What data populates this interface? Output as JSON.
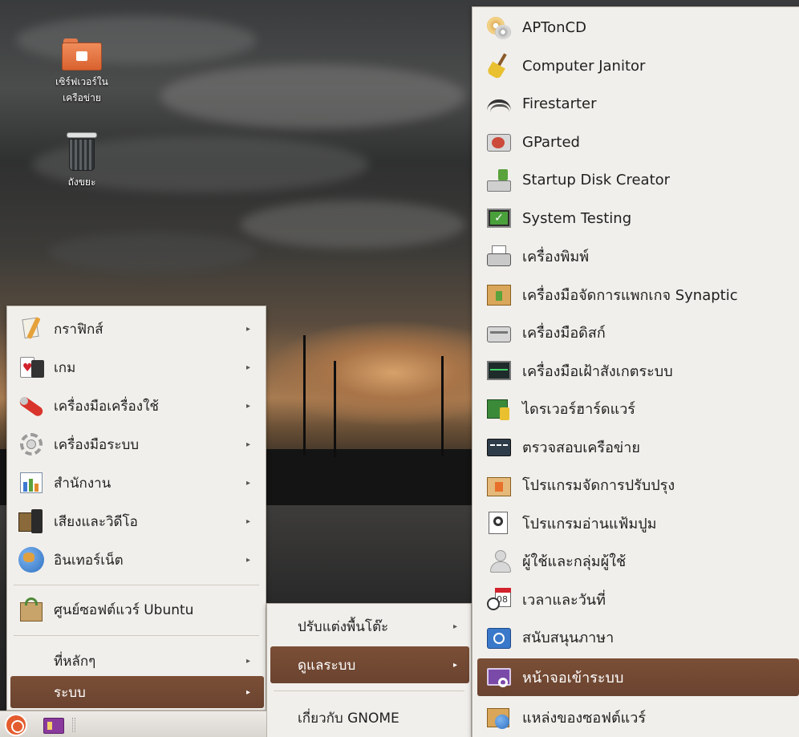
{
  "desktop": {
    "icons": [
      {
        "label_line1": "เซิร์ฟเวอร์ใน",
        "label_line2": "เครือข่าย",
        "icon": "network-folder-icon"
      },
      {
        "label": "ถังขยะ",
        "icon": "trash-icon"
      }
    ]
  },
  "main_menu": {
    "items": [
      {
        "label": "กราฟิกส์",
        "icon": "graphics-icon"
      },
      {
        "label": "เกม",
        "icon": "games-icon"
      },
      {
        "label": "เครื่องมือเครื่องใช้",
        "icon": "accessories-icon"
      },
      {
        "label": "เครื่องมือระบบ",
        "icon": "system-tools-icon"
      },
      {
        "label": "สำนักงาน",
        "icon": "office-icon"
      },
      {
        "label": "เสียงและวิดีโอ",
        "icon": "sound-video-icon"
      },
      {
        "label": "อินเทอร์เน็ต",
        "icon": "internet-icon"
      },
      {
        "label": "ศูนย์ซอฟต์แวร์ Ubuntu",
        "icon": "software-center-icon"
      },
      {
        "label": "ที่หลักๆ"
      },
      {
        "label": "ระบบ"
      }
    ],
    "selected": "ระบบ"
  },
  "system_submenu": {
    "items": [
      {
        "label": "ปรับแต่งพื้นโต๊ะ"
      },
      {
        "label": "ดูแลระบบ"
      },
      {
        "label": "เกี่ยวกับ GNOME"
      }
    ],
    "selected": "ดูแลระบบ"
  },
  "admin_menu": {
    "items": [
      {
        "label": "APTonCD",
        "icon": "aptoncd-icon"
      },
      {
        "label": "Computer Janitor",
        "icon": "broom-icon"
      },
      {
        "label": "Firestarter",
        "icon": "firestarter-icon"
      },
      {
        "label": "GParted",
        "icon": "gparted-icon"
      },
      {
        "label": "Startup Disk Creator",
        "icon": "startup-disk-icon"
      },
      {
        "label": "System Testing",
        "icon": "system-testing-icon"
      },
      {
        "label": "เครื่องพิมพ์",
        "icon": "printer-icon"
      },
      {
        "label": "เครื่องมือจัดการแพกเกจ Synaptic",
        "icon": "synaptic-icon"
      },
      {
        "label": "เครื่องมือดิสก์",
        "icon": "disk-utility-icon"
      },
      {
        "label": "เครื่องมือเฝ้าสังเกตระบบ",
        "icon": "system-monitor-icon"
      },
      {
        "label": "ไดรเวอร์ฮาร์ดแวร์",
        "icon": "hardware-drivers-icon"
      },
      {
        "label": "ตรวจสอบเครือข่าย",
        "icon": "network-tools-icon"
      },
      {
        "label": "โปรแกรมจัดการปรับปรุง",
        "icon": "update-manager-icon"
      },
      {
        "label": "โปรแกรมอ่านแฟ้มปูม",
        "icon": "log-viewer-icon"
      },
      {
        "label": "ผู้ใช้และกลุ่มผู้ใช้",
        "icon": "users-groups-icon"
      },
      {
        "label": "เวลาและวันที่",
        "icon": "time-date-icon"
      },
      {
        "label": "สนับสนุนภาษา",
        "icon": "language-support-icon"
      },
      {
        "label": "หน้าจอเข้าระบบ",
        "icon": "login-screen-icon"
      },
      {
        "label": "แหล่งของซอฟต์แวร์",
        "icon": "software-sources-icon"
      }
    ],
    "selected": "หน้าจอเข้าระบบ",
    "calendar_icon_number": "08"
  },
  "colors": {
    "selection": "#6f4632",
    "menu_background": "#f1efeb",
    "ubuntu_orange": "#e45c2e"
  },
  "panel": {
    "icons": [
      "ubuntu-menu-icon",
      "launcher-icon"
    ]
  }
}
